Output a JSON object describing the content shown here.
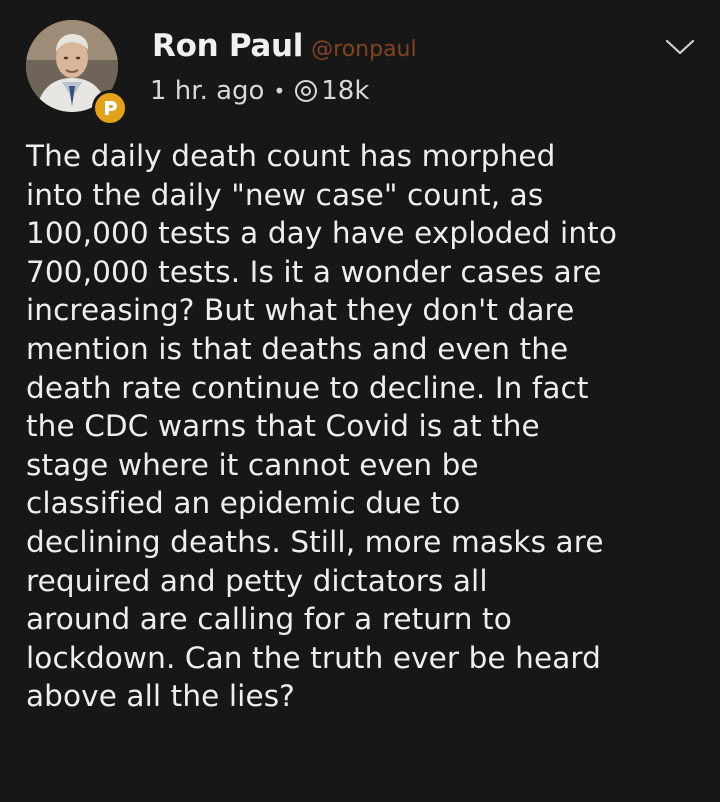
{
  "post": {
    "author": {
      "display_name": "Ron Paul",
      "handle": "@ronpaul",
      "avatar_icon": "avatar-photo",
      "badge_icon": "parler-badge-icon"
    },
    "meta": {
      "time": "1 hr. ago",
      "separator": "•",
      "views_icon": "eye-icon",
      "views": "18k"
    },
    "menu_icon": "chevron-down-icon",
    "text": "The daily death count has morphed\ninto the daily \"new case\" count, as\n100,000 tests a day have exploded into\n700,000 tests. Is it a wonder cases are\nincreasing? But what they don't dare\nmention is that deaths and even the\ndeath rate continue to decline. In fact\nthe CDC warns that Covid is at the\nstage where it cannot even be\nclassified an epidemic due to\ndeclining deaths. Still, more masks are\nrequired and petty dictators all\naround are calling for a return to\nlockdown. Can the truth ever be heard\nabove all the lies?"
  },
  "colors": {
    "background": "#171717",
    "text": "#eeeeee",
    "handle": "#d96a2c",
    "badge": "#e2a21c"
  }
}
